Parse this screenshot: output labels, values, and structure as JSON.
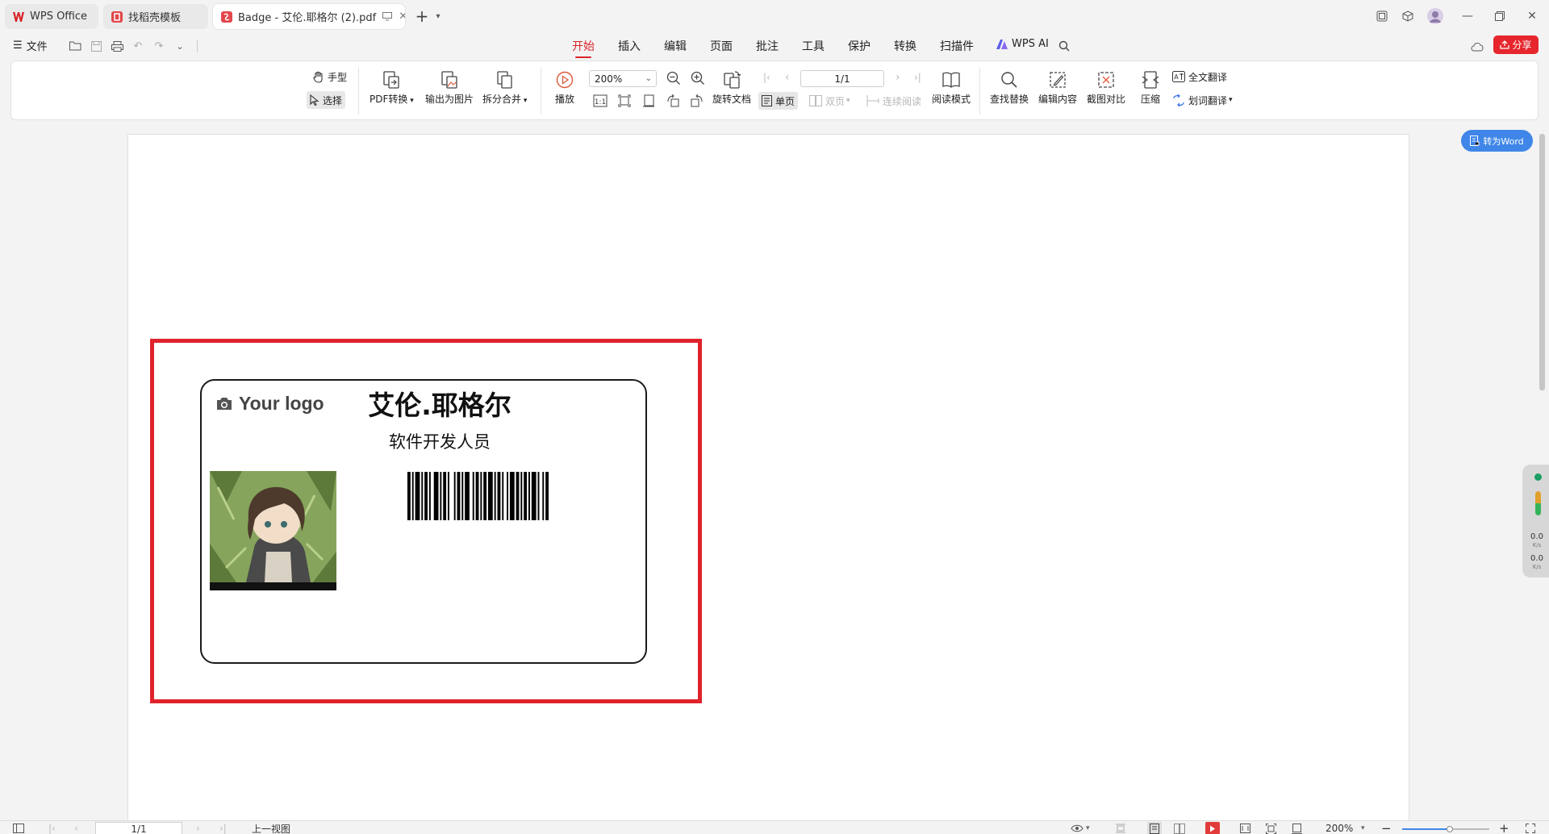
{
  "tabs": [
    {
      "label": "WPS Office",
      "icon": "wps-logo-icon"
    },
    {
      "label": "找稻壳模板",
      "icon": "docer-icon"
    },
    {
      "label": "Badge - 艾伦.耶格尔 (2).pdf",
      "icon": "pdf-icon"
    }
  ],
  "menu": {
    "file_label": "文件",
    "tabs": [
      "开始",
      "插入",
      "编辑",
      "页面",
      "批注",
      "工具",
      "保护",
      "转换",
      "扫描件"
    ],
    "active_tab": "开始",
    "wps_ai_label": "WPS AI",
    "share_label": "分享"
  },
  "ribbon": {
    "hand": "手型",
    "select": "选择",
    "pdf_convert": "PDF转换",
    "export_image": "输出为图片",
    "split_merge": "拆分合并",
    "play": "播放",
    "zoom_value": "200%",
    "page_value": "1/1",
    "rotate_doc": "旋转文档",
    "single_page": "单页",
    "double_page": "双页",
    "continuous": "连续阅读",
    "read_mode": "阅读模式",
    "find_replace": "查找替换",
    "edit_content": "编辑内容",
    "screenshot_compare": "截图对比",
    "compress": "压缩",
    "full_translate": "全文翻译",
    "word_translate": "划词翻译"
  },
  "side": {
    "to_word": "转为Word",
    "speed_up": "0.0",
    "speed_up_unit": "K/s",
    "speed_down": "0.0",
    "speed_down_unit": "K/s"
  },
  "badge": {
    "logo_text": "Your logo",
    "name": "艾伦.耶格尔",
    "title": "软件开发人员",
    "barcode": [
      2,
      1,
      1,
      1,
      3,
      1,
      1,
      1,
      2,
      1,
      1,
      2,
      3,
      1,
      1,
      1,
      2,
      1,
      1,
      3,
      1,
      1,
      2,
      1,
      1,
      1,
      3,
      2,
      1,
      1,
      2,
      1,
      1,
      1,
      2,
      1,
      3,
      1,
      1,
      1,
      2,
      1,
      1,
      2,
      1,
      1,
      3,
      1,
      2,
      1,
      1,
      1,
      2,
      1,
      1,
      1,
      3,
      1,
      1,
      2,
      1,
      1,
      2
    ]
  },
  "status": {
    "page_value": "1/1",
    "prev_view": "上一视图",
    "zoom": "200%",
    "zoom_level": 0.55
  }
}
